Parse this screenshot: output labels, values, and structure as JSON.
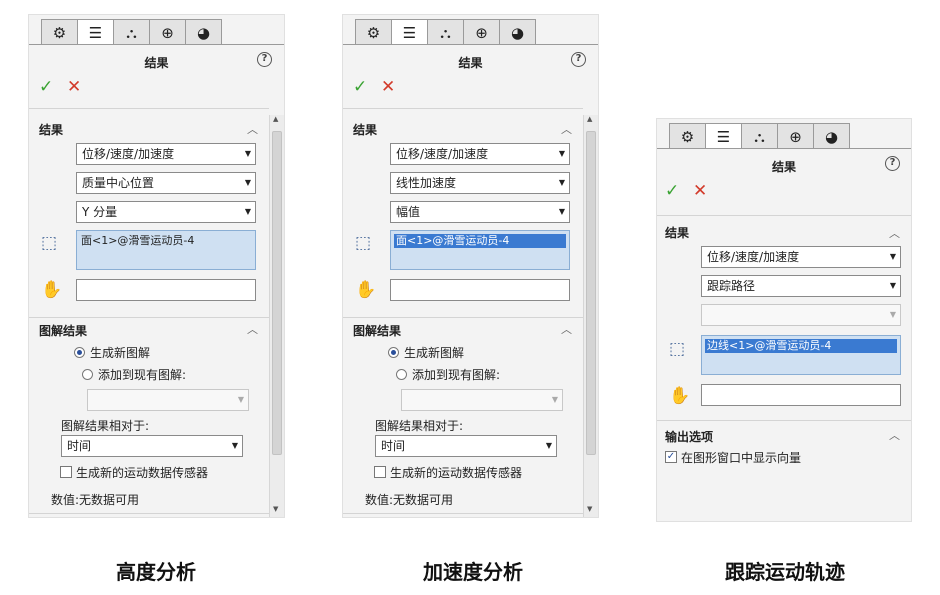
{
  "tab_icons": [
    "feature-manager-icon",
    "property-manager-icon",
    "configuration-manager-icon",
    "dimxpert-icon",
    "display-manager-icon"
  ],
  "panels": [
    {
      "title": "结果",
      "help": "?",
      "ok": "✓",
      "cancel": "✕",
      "results_section": "结果",
      "dropdowns": [
        "位移/速度/加速度",
        "质量中心位置",
        "Y 分量"
      ],
      "selection_item": "面<1>@滑雪运动员-4",
      "plot_section": "图解结果",
      "radio_new": "生成新图解",
      "radio_add": "添加到现有图解:",
      "relative_label": "图解结果相对于:",
      "relative_value": "时间",
      "sensor_checkbox": "生成新的运动数据传感器",
      "value_text": "数值:无数据可用"
    },
    {
      "title": "结果",
      "help": "?",
      "ok": "✓",
      "cancel": "✕",
      "results_section": "结果",
      "dropdowns": [
        "位移/速度/加速度",
        "线性加速度",
        "幅值"
      ],
      "selection_item": "面<1>@滑雪运动员-4",
      "plot_section": "图解结果",
      "radio_new": "生成新图解",
      "radio_add": "添加到现有图解:",
      "relative_label": "图解结果相对于:",
      "relative_value": "时间",
      "sensor_checkbox": "生成新的运动数据传感器",
      "value_text": "数值:无数据可用"
    },
    {
      "title": "结果",
      "help": "?",
      "ok": "✓",
      "cancel": "✕",
      "results_section": "结果",
      "dropdowns": [
        "位移/速度/加速度",
        "跟踪路径",
        ""
      ],
      "selection_item": "边线<1>@滑雪运动员-4",
      "output_section": "输出选项",
      "output_checkbox": "在图形窗口中显示向量"
    }
  ],
  "captions": [
    "高度分析",
    "加速度分析",
    "跟踪运动轨迹"
  ],
  "colors": {
    "ok": "#3aa332",
    "cancel": "#d23a2a",
    "selection_bg": "#cfe0f2",
    "selection_highlight": "#3a7ad1"
  }
}
